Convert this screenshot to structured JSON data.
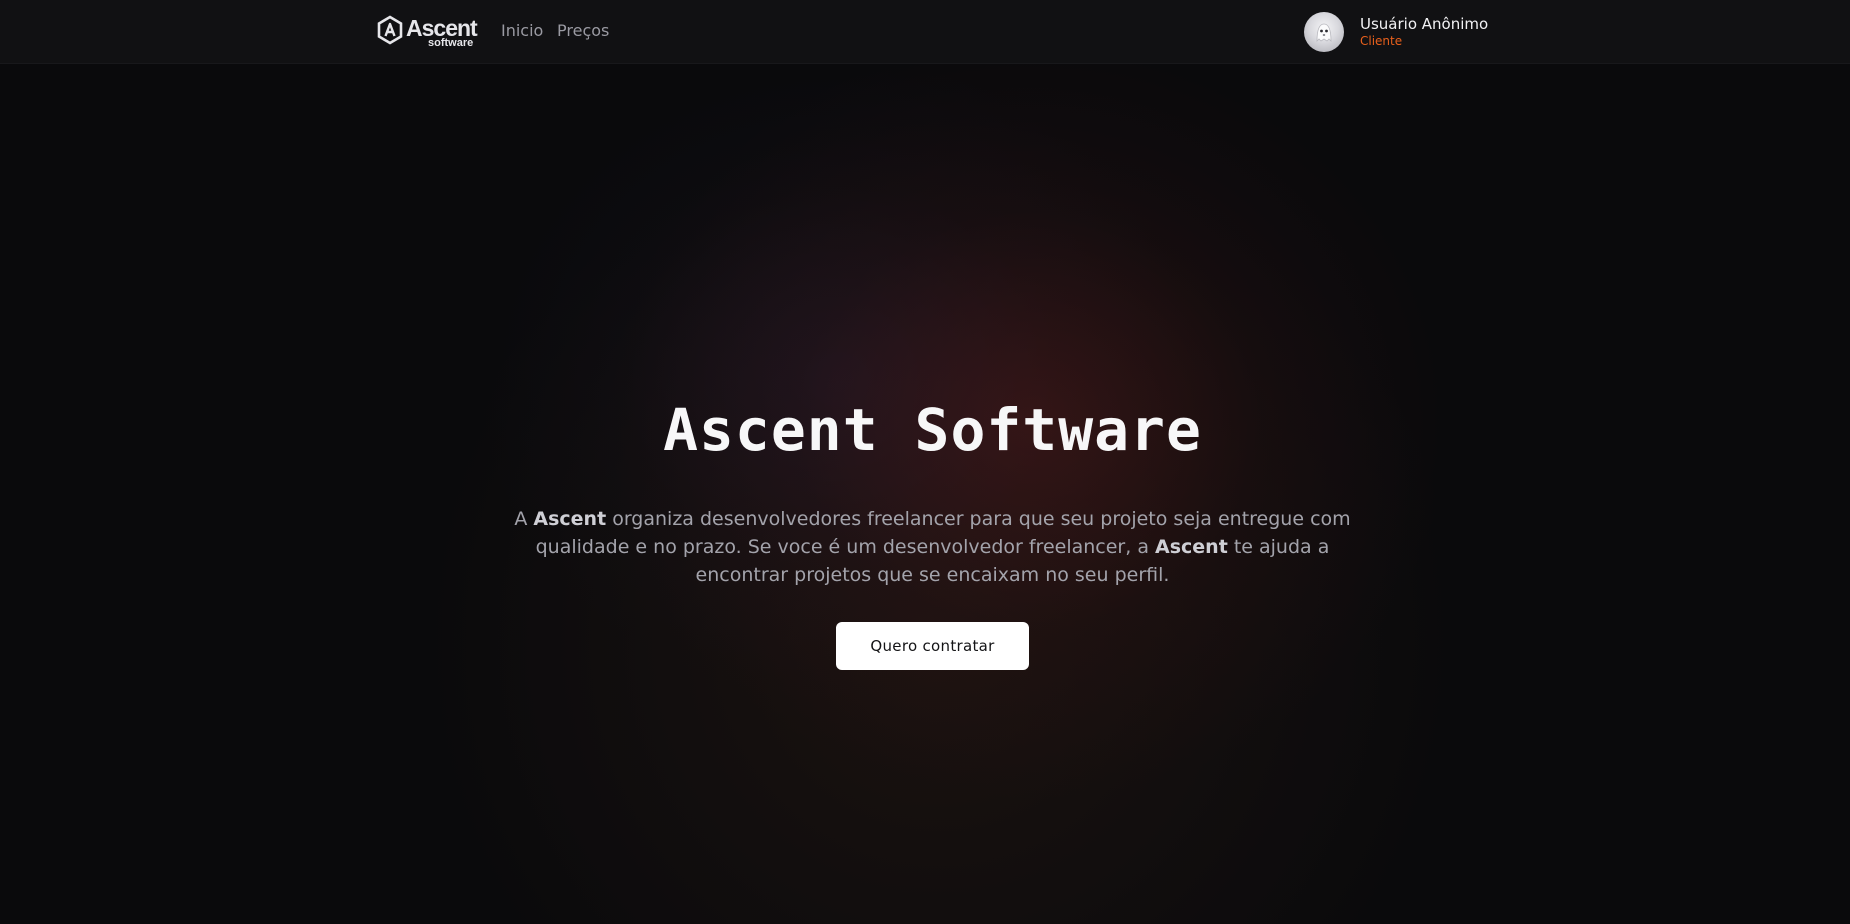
{
  "nav": {
    "brand": {
      "name": "Ascent",
      "sub": "software",
      "icon": "ascent-hexagon-logo"
    },
    "links": [
      {
        "label": "Inicio"
      },
      {
        "label": "Preços"
      }
    ]
  },
  "user": {
    "name": "Usuário Anônimo",
    "role": "Cliente",
    "avatar_icon": "ghost-avatar"
  },
  "hero": {
    "title": "Ascent Software",
    "text_parts": {
      "p1": "A ",
      "b1": "Ascent",
      "p2": " organiza desenvolvedores freelancer para que seu projeto seja entregue com qualidade e no prazo. Se voce é um desenvolvedor freelancer, a ",
      "b2": "Ascent",
      "p3": " te ajuda a encontrar projetos que se encaixam no seu perfil."
    },
    "cta_label": "Quero contratar"
  },
  "colors": {
    "background": "#0a0a0c",
    "navbar": "#111113",
    "accent_role": "#e8601c",
    "button_bg": "#ffffff"
  }
}
